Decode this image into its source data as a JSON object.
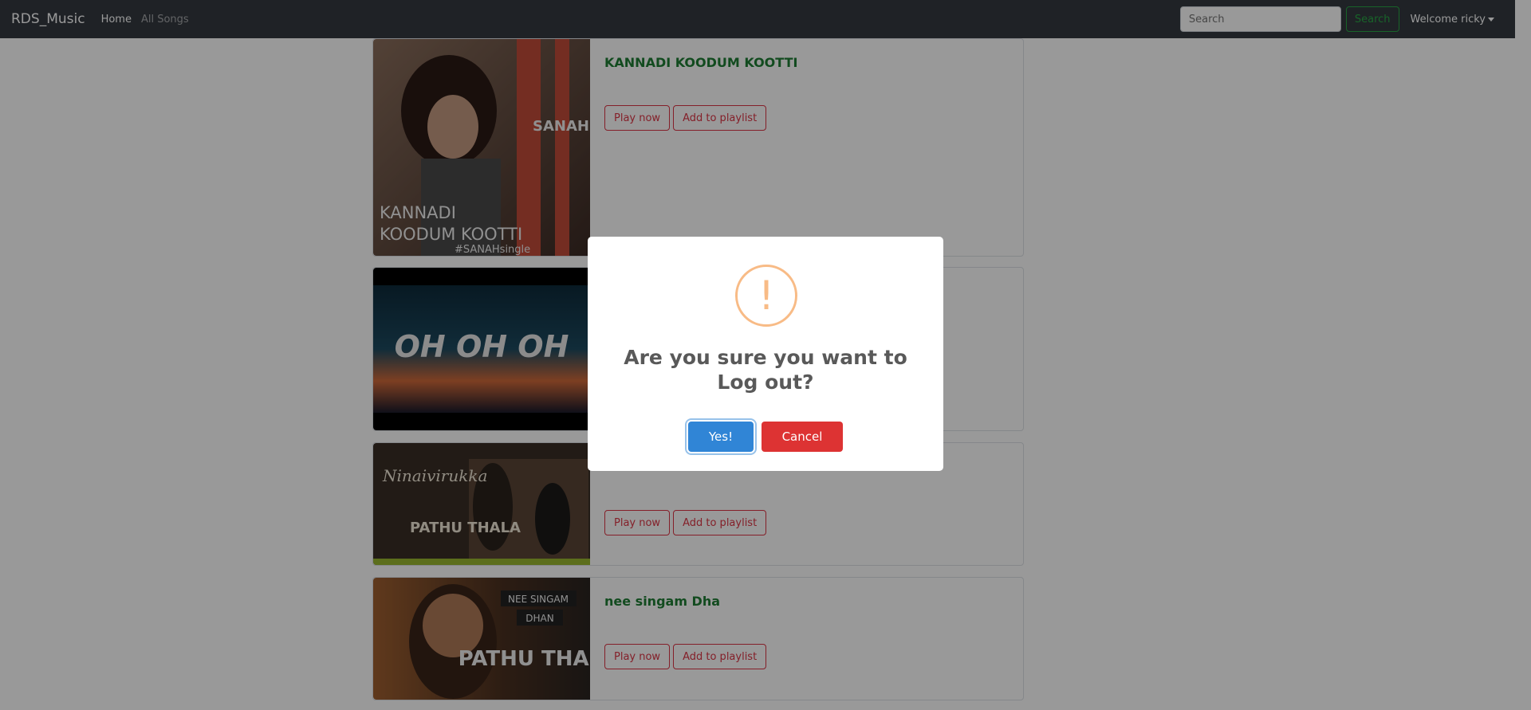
{
  "navbar": {
    "brand": "RDS_Music",
    "links": [
      {
        "label": "Home"
      },
      {
        "label": "All Songs"
      }
    ],
    "search": {
      "placeholder": "Search",
      "value": ""
    },
    "search_button": "Search",
    "user_menu": "Welcome ricky"
  },
  "songs": [
    {
      "title": "KANNADI KOODUM KOOTTI",
      "artwork_text": [
        "SANAH MOIDUTTY",
        "KANNADI",
        "KOODUM KOOTTI",
        "#SANAHsingle"
      ],
      "play_label": "Play now",
      "playlist_label": "Add to playlist"
    },
    {
      "title": "",
      "artwork_text": [
        "OH OH OH"
      ],
      "play_label": "",
      "playlist_label": ""
    },
    {
      "title": "",
      "artwork_text": [
        "Ninaivirukka",
        "PATHU THALA"
      ],
      "play_label": "Play now",
      "playlist_label": "Add to playlist"
    },
    {
      "title": "nee singam Dha",
      "artwork_text": [
        "NEE SINGAM",
        "DHAN"
      ],
      "play_label": "Play now",
      "playlist_label": "Add to playlist"
    }
  ],
  "dialog": {
    "icon": "!",
    "title": "Are you sure you want to Log out?",
    "confirm_label": "Yes!",
    "cancel_label": "Cancel"
  },
  "colors": {
    "navbar_bg": "#343a40",
    "song_title": "#1e7e34",
    "outline_danger": "#dc3545",
    "confirm": "#3085d6",
    "cancel": "#dd3333",
    "warning_icon": "#f8bb86"
  }
}
